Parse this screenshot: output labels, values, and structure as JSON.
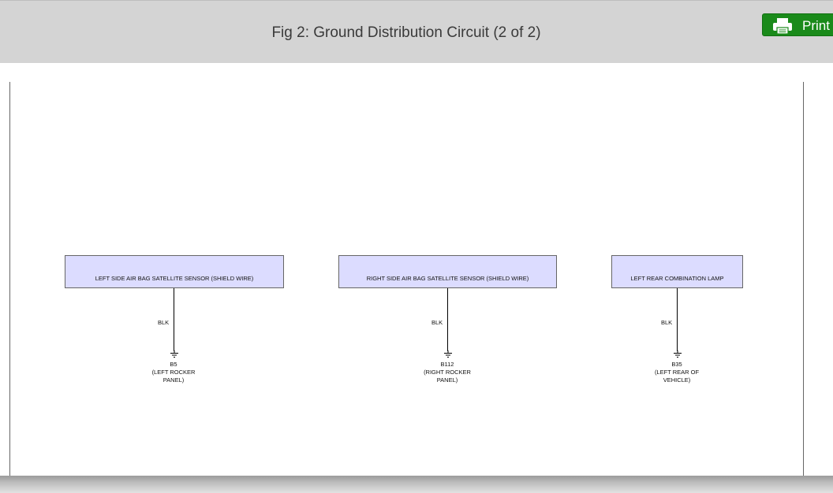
{
  "header": {
    "title": "Fig 2: Ground Distribution Circuit (2 of 2)",
    "print_label": "Print"
  },
  "colors": {
    "header_bg": "#d4d4d4",
    "component_fill": "#dcdcff",
    "print_button": "#1a8a1a"
  },
  "circuits": [
    {
      "component": "LEFT SIDE AIR BAG SATELLITE SENSOR (SHIELD WIRE)",
      "wire_color": "BLK",
      "ground_id": "B5",
      "ground_loc_1": "(LEFT ROCKER",
      "ground_loc_2": "PANEL)"
    },
    {
      "component": "RIGHT SIDE AIR BAG SATELLITE SENSOR (SHIELD WIRE)",
      "wire_color": "BLK",
      "ground_id": "B112",
      "ground_loc_1": "(RIGHT ROCKER",
      "ground_loc_2": "PANEL)"
    },
    {
      "component": "LEFT REAR COMBINATION LAMP",
      "wire_color": "BLK",
      "ground_id": "B35",
      "ground_loc_1": "(LEFT REAR OF",
      "ground_loc_2": "VEHICLE)"
    }
  ]
}
